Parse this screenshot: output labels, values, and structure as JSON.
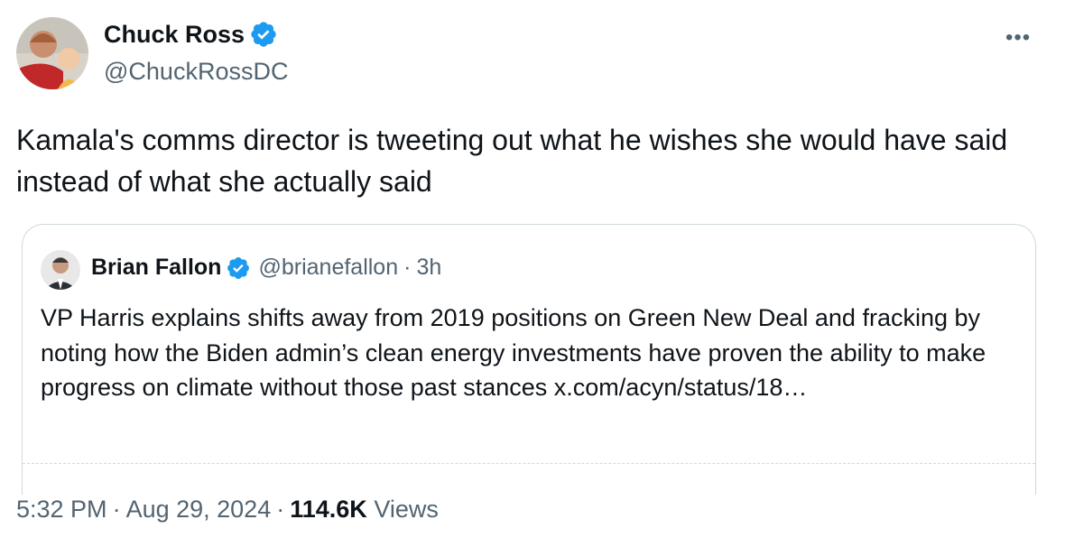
{
  "author": {
    "name": "Chuck Ross",
    "handle": "@ChuckRossDC"
  },
  "more_icon": "•••",
  "tweet_text": "Kamala's comms director is tweeting out what he wishes she would have said instead of what she actually said",
  "quote": {
    "name": "Brian Fallon",
    "handle": "@brianefallon",
    "separator": "·",
    "time": "3h",
    "text": "VP Harris explains shifts away from 2019 positions on Green New Deal and fracking by noting how the Biden admin’s clean energy investments have proven the ability to make progress on climate without those past stances x.com/acyn/status/18…"
  },
  "footer": {
    "time": "5:32 PM",
    "separator": "·",
    "date": "Aug 29, 2024",
    "views_count": "114.6K",
    "views_label": "Views"
  },
  "colors": {
    "verified": "#1d9bf0",
    "secondary_text": "#536471",
    "primary_text": "#0f1419",
    "border": "#cfd9de"
  },
  "icons": [
    "verified-badge-icon",
    "more-options-icon"
  ]
}
